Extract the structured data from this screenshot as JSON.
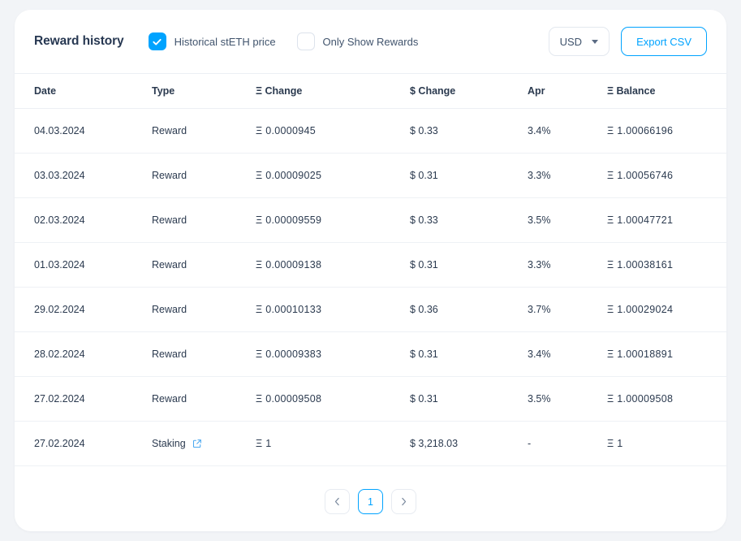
{
  "header": {
    "title": "Reward history",
    "filters": [
      {
        "label": "Historical stETH price",
        "checked": true
      },
      {
        "label": "Only Show Rewards",
        "checked": false
      }
    ],
    "currency": "USD",
    "export_label": "Export CSV"
  },
  "table": {
    "columns": [
      "Date",
      "Type",
      "Ξ Change",
      "$ Change",
      "Apr",
      "Ξ Balance"
    ],
    "rows": [
      {
        "date": "04.03.2024",
        "type": "Reward",
        "eth_change": "Ξ 0.0000945",
        "usd_change": "$ 0.33",
        "apr": "3.4%",
        "balance": "Ξ 1.00066196",
        "has_link": false
      },
      {
        "date": "03.03.2024",
        "type": "Reward",
        "eth_change": "Ξ 0.00009025",
        "usd_change": "$ 0.31",
        "apr": "3.3%",
        "balance": "Ξ 1.00056746",
        "has_link": false
      },
      {
        "date": "02.03.2024",
        "type": "Reward",
        "eth_change": "Ξ 0.00009559",
        "usd_change": "$ 0.33",
        "apr": "3.5%",
        "balance": "Ξ 1.00047721",
        "has_link": false
      },
      {
        "date": "01.03.2024",
        "type": "Reward",
        "eth_change": "Ξ 0.00009138",
        "usd_change": "$ 0.31",
        "apr": "3.3%",
        "balance": "Ξ 1.00038161",
        "has_link": false
      },
      {
        "date": "29.02.2024",
        "type": "Reward",
        "eth_change": "Ξ 0.00010133",
        "usd_change": "$ 0.36",
        "apr": "3.7%",
        "balance": "Ξ 1.00029024",
        "has_link": false
      },
      {
        "date": "28.02.2024",
        "type": "Reward",
        "eth_change": "Ξ 0.00009383",
        "usd_change": "$ 0.31",
        "apr": "3.4%",
        "balance": "Ξ 1.00018891",
        "has_link": false
      },
      {
        "date": "27.02.2024",
        "type": "Reward",
        "eth_change": "Ξ 0.00009508",
        "usd_change": "$ 0.31",
        "apr": "3.5%",
        "balance": "Ξ 1.00009508",
        "has_link": false
      },
      {
        "date": "27.02.2024",
        "type": "Staking",
        "eth_change": "Ξ 1",
        "usd_change": "$ 3,218.03",
        "apr": "-",
        "balance": "Ξ 1",
        "has_link": true
      }
    ]
  },
  "pagination": {
    "prev_icon": "chevron-left-icon",
    "next_icon": "chevron-right-icon",
    "pages": [
      "1"
    ],
    "current": "1"
  },
  "colors": {
    "accent": "#00a3ff",
    "green": "#53ba95",
    "text": "#2b3a4f",
    "page_bg": "#f2f4f7",
    "card_bg": "#ffffff",
    "border": "#eef1f5"
  }
}
